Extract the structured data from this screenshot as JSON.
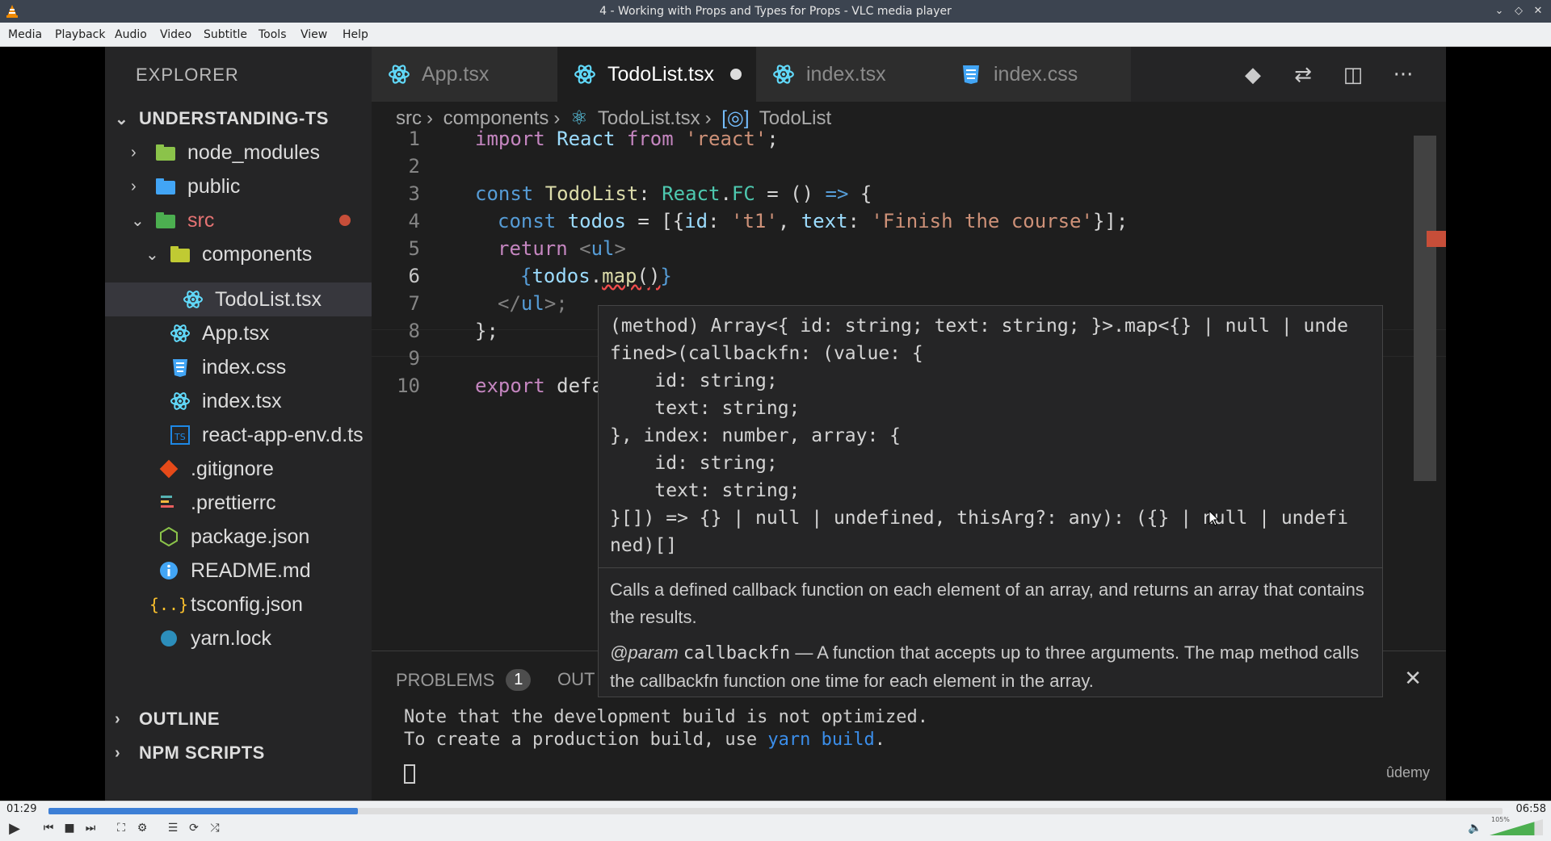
{
  "window": {
    "title": "4 - Working with Props and Types for Props - VLC media player"
  },
  "menu": [
    "Media",
    "Playback",
    "Audio",
    "Video",
    "Subtitle",
    "Tools",
    "View",
    "Help"
  ],
  "explorer": {
    "title": "EXPLORER",
    "root": "UNDERSTANDING-TS",
    "items": [
      "node_modules",
      "public",
      "src",
      "components",
      "TodoList.tsx",
      "App.tsx",
      "index.css",
      "index.tsx",
      "react-app-env.d.ts",
      ".gitignore",
      ".prettierrc",
      "package.json",
      "README.md",
      "tsconfig.json",
      "yarn.lock"
    ],
    "outline": "OUTLINE",
    "npm_scripts": "NPM SCRIPTS"
  },
  "tabs": [
    "App.tsx",
    "TodoList.tsx",
    "index.tsx",
    "index.css"
  ],
  "breadcrumb": [
    "src",
    "components",
    "TodoList.tsx",
    "TodoList"
  ],
  "line_numbers": [
    "1",
    "2",
    "3",
    "4",
    "5",
    "6",
    "7",
    "8",
    "9",
    "10"
  ],
  "code": {
    "l1": [
      "import",
      " React ",
      "from",
      " 'react'",
      ";"
    ],
    "l3": [
      "const",
      " TodoList",
      ": ",
      "React",
      ".",
      "FC",
      " = () ",
      "=>",
      " {"
    ],
    "l4": [
      "const",
      " todos",
      " = [{",
      "id",
      ": ",
      "'t1'",
      ", ",
      "text",
      ": ",
      "'Finish the course'",
      "}];"
    ],
    "l5": [
      "return",
      " <",
      "ul",
      ">"
    ],
    "l6": [
      "{",
      "todos",
      ".",
      "map",
      "()",
      "}"
    ],
    "l7": [
      "</",
      "ul",
      ">;"
    ],
    "l8": "};",
    "l10": [
      "export",
      " defa"
    ]
  },
  "hover": {
    "signature": "(method) Array<{ id: string; text: string; }>.map<{} | null | unde\nfined>(callbackfn: (value: {\n    id: string;\n    text: string;\n}, index: number, array: {\n    id: string;\n    text: string;\n}[]) => {} | null | undefined, thisArg?: any): ({} | null | undefi\nned)[]",
    "description": "Calls a defined callback function on each element of an array, and returns an array that contains the results.",
    "param_tag": "@param",
    "param_name": "callbackfn",
    "param_desc": " — A function that accepts up to three arguments. The map method calls the callbackfn function one time for each element in the array."
  },
  "panel": {
    "problems_label": "PROBLEMS",
    "problems_count": "1",
    "output_label": "OUT",
    "terminal_line1": "Note that the development build is not optimized.",
    "terminal_line2_prefix": "To create a production build, use ",
    "terminal_line2_cmd": "yarn build",
    "terminal_line2_suffix": "."
  },
  "watermark": "ûdemy",
  "player": {
    "elapsed": "01:29",
    "total": "06:58",
    "progress": 0.213,
    "volume_label": "105%",
    "volume": 1.05
  }
}
